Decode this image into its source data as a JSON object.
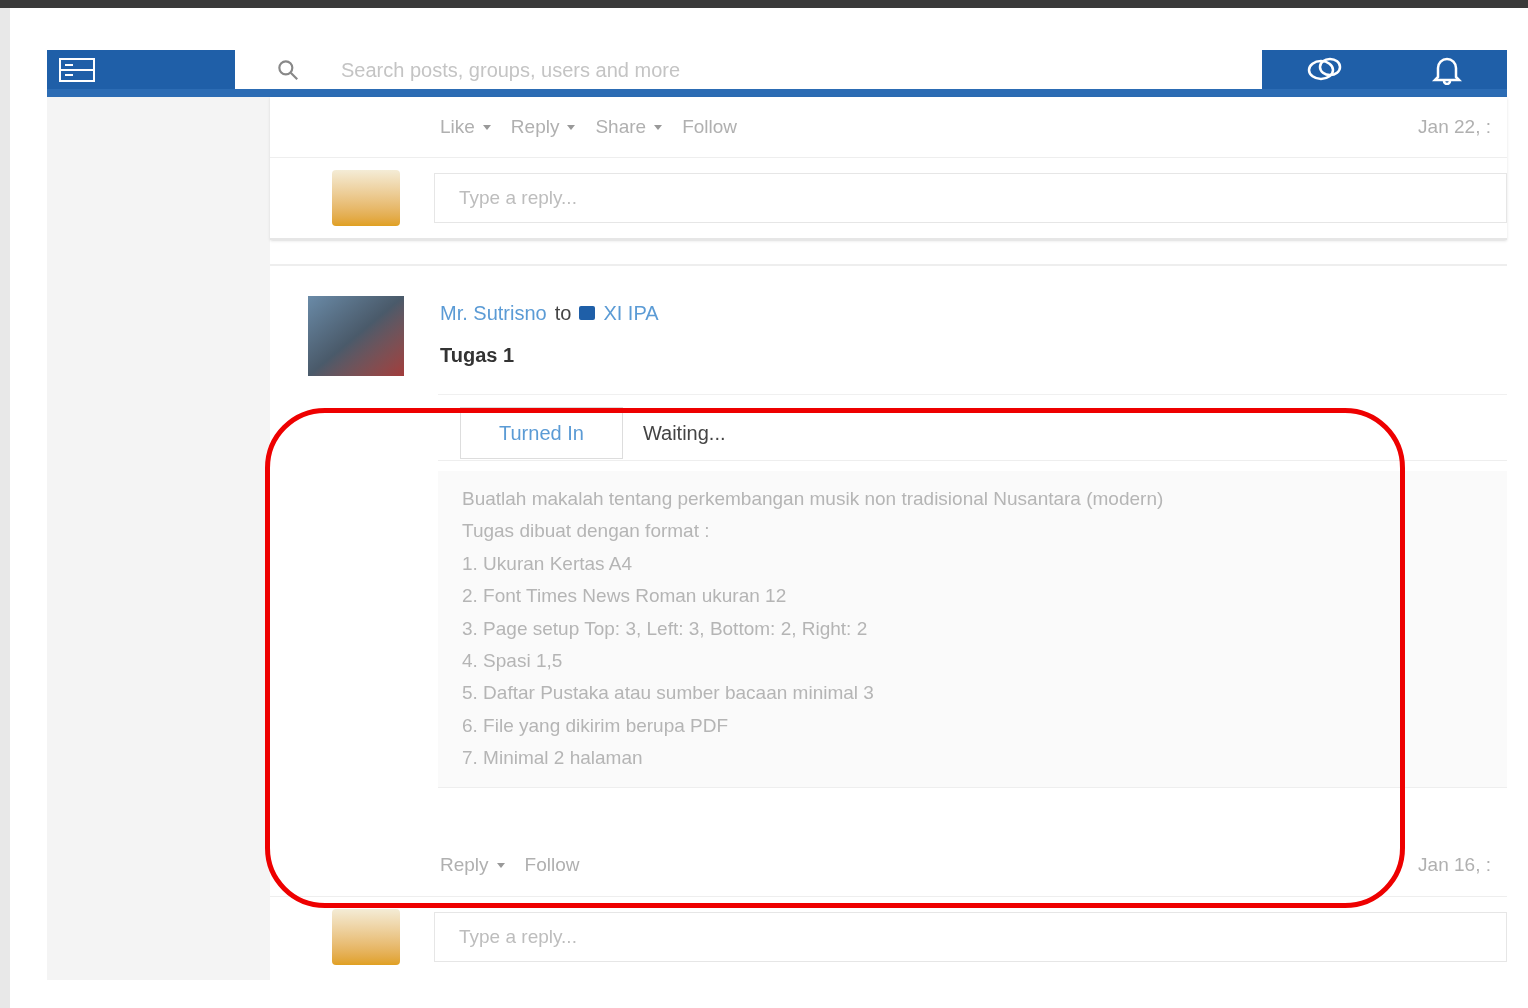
{
  "header": {
    "search": {
      "placeholder": "Search posts, groups, users and more"
    }
  },
  "posts": [
    {
      "actions": [
        {
          "label": "Like",
          "dropdown": true
        },
        {
          "label": "Reply",
          "dropdown": true
        },
        {
          "label": "Share",
          "dropdown": true
        },
        {
          "label": "Follow",
          "dropdown": false
        }
      ],
      "date": "Jan 22, :",
      "reply": {
        "placeholder": "Type a reply..."
      }
    },
    {
      "author": "Mr. Sutrisno",
      "connector": "to",
      "group": "XI IPA",
      "title": "Tugas 1",
      "tabs": [
        {
          "label": "Turned In",
          "selected": true
        },
        {
          "label": "Waiting...",
          "selected": false
        }
      ],
      "body": [
        "Buatlah makalah tentang perkembangan musik non tradisional Nusantara (modern)",
        "Tugas dibuat dengan format :",
        "1. Ukuran Kertas A4",
        "2. Font Times News Roman ukuran 12",
        "3. Page setup Top: 3, Left: 3, Bottom: 2, Right: 2",
        "4. Spasi 1,5",
        "5. Daftar Pustaka atau sumber bacaan minimal 3",
        "6. File yang dikirim berupa PDF",
        "7. Minimal 2 halaman"
      ],
      "actions": [
        {
          "label": "Reply",
          "dropdown": true
        },
        {
          "label": "Follow",
          "dropdown": false
        }
      ],
      "date": "Jan 16, :",
      "reply": {
        "placeholder": "Type a reply..."
      }
    }
  ]
}
